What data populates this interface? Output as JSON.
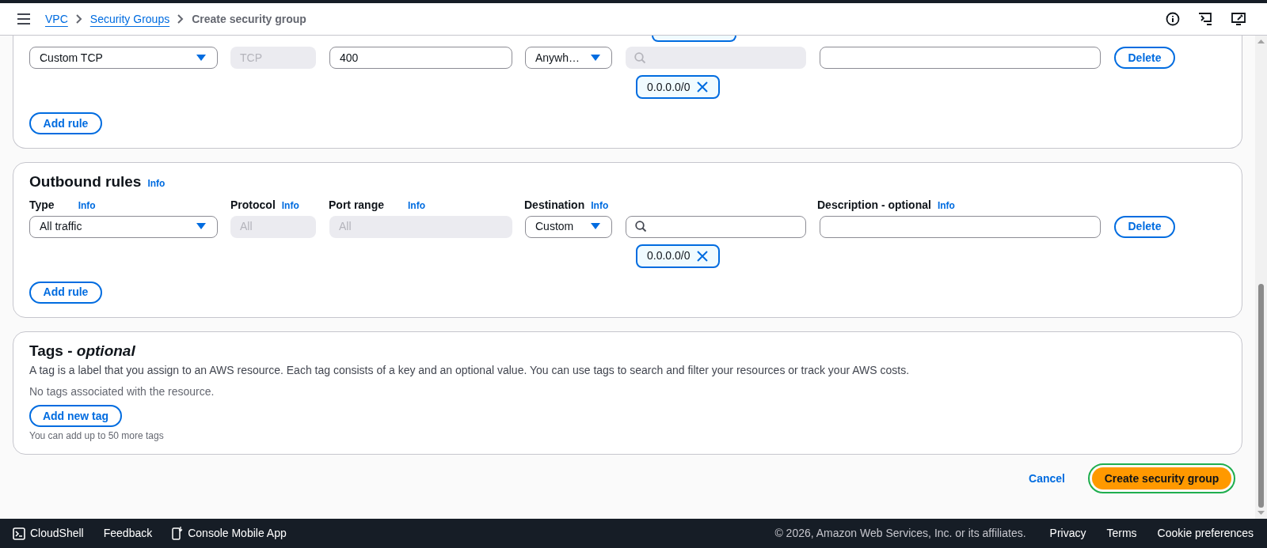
{
  "breadcrumbs": [
    {
      "label": "VPC",
      "link": true
    },
    {
      "label": "Security Groups",
      "link": true
    },
    {
      "label": "Create security group",
      "link": false
    }
  ],
  "inbound_rules": {
    "rows": [
      {
        "type": "Custom TCP",
        "protocol": "TCP",
        "protocol_disabled": true,
        "port_range": "400",
        "port_disabled": false,
        "source_type": "Anywh…",
        "search_disabled": true,
        "chips": [
          "0.0.0.0/0"
        ],
        "delete": "Delete"
      }
    ],
    "add_rule": "Add rule"
  },
  "outbound_rules": {
    "title": "Outbound rules",
    "info": "Info",
    "columns": [
      {
        "label": "Type",
        "info": "Info"
      },
      {
        "label": "Protocol",
        "info": "Info"
      },
      {
        "label": "Port range",
        "info": "Info"
      },
      {
        "label": "Destination",
        "info": "Info"
      },
      {
        "label": "Description - optional",
        "info": "Info"
      }
    ],
    "rows": [
      {
        "type": "All traffic",
        "protocol": "All",
        "protocol_disabled": true,
        "port_range": "All",
        "port_disabled": true,
        "source_type": "Custom",
        "search_disabled": false,
        "chips": [
          "0.0.0.0/0"
        ],
        "delete": "Delete"
      }
    ],
    "add_rule": "Add rule"
  },
  "tags": {
    "title": "Tags - *optional*",
    "description": "A tag is a label that you assign to an AWS resource. Each tag consists of a key and an optional value. You can use tags to search and filter your resources or track your AWS costs.",
    "empty": "No tags associated with the resource.",
    "add_button": "Add new tag",
    "hint": "You can add up to 50 more tags"
  },
  "actions": {
    "cancel": "Cancel",
    "create": "Create security group",
    "create_focused": true
  },
  "footer": {
    "left": [
      {
        "label": "CloudShell",
        "kind": "terminal"
      },
      {
        "label": "Feedback",
        "kind": "plain"
      },
      {
        "label": "Console Mobile App",
        "kind": "phone"
      }
    ],
    "copyright": "© 2026, Amazon Web Services, Inc. or its affiliates.",
    "links": [
      "Privacy",
      "Terms",
      "Cookie preferences"
    ]
  }
}
